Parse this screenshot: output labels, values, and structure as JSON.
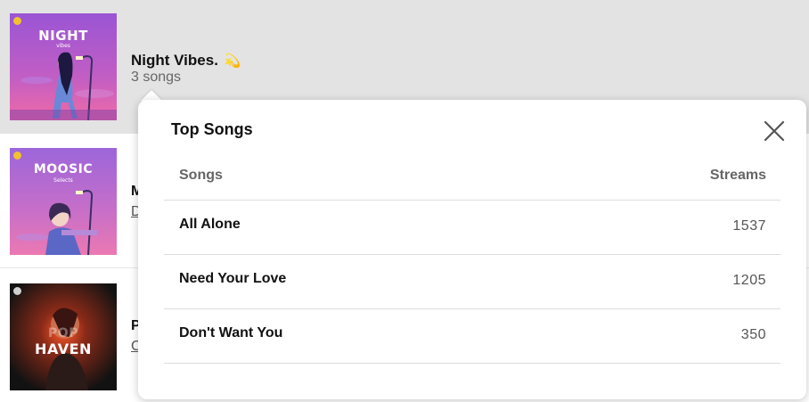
{
  "playlists": [
    {
      "cover_title": "NIGHT",
      "cover_sub": "vibes",
      "title": "Night Vibes.",
      "emoji": "💫",
      "count": "3 songs",
      "colors": {
        "bg_top": "#a35bd6",
        "bg_bottom": "#e85aa8"
      }
    },
    {
      "cover_title": "MOOSIC",
      "cover_sub": "Selects",
      "title_partial": "M",
      "sub_partial": "D",
      "colors": {
        "bg_top": "#9a62d9",
        "bg_bottom": "#e06bb4"
      }
    },
    {
      "cover_title": "HAVEN",
      "cover_title_back": "POP",
      "title_partial": "P",
      "sub_partial": "C",
      "colors": {
        "bg_top": "#1b1b1b",
        "bg_bottom": "#3a2a22"
      }
    }
  ],
  "popover": {
    "title": "Top Songs",
    "close_icon": "close-icon",
    "columns": {
      "songs": "Songs",
      "streams": "Streams"
    },
    "rows": [
      {
        "song": "All Alone",
        "streams": "1537"
      },
      {
        "song": "Need Your Love",
        "streams": "1205"
      },
      {
        "song": "Don't Want You",
        "streams": "350"
      }
    ]
  }
}
